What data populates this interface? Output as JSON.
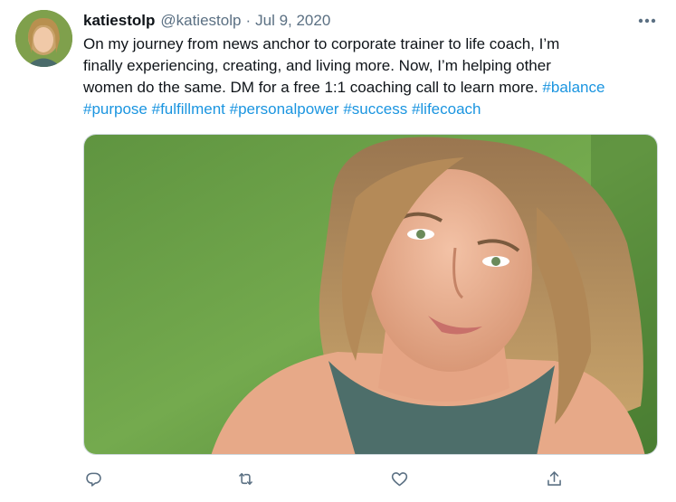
{
  "tweet": {
    "display_name": "katiestolp",
    "handle": "@katiestolp",
    "separator": "·",
    "date": "Jul 9, 2020",
    "text_lines": [
      "On my journey from news anchor to corporate trainer to life coach, I’m",
      "finally experiencing, creating, and living more. Now, I’m helping other",
      "women do the same. DM for a free 1:1 coaching call to learn more. "
    ],
    "hashtags_line3": [
      "#balance"
    ],
    "hashtags_line4": [
      "#purpose",
      "#fulfillment",
      "#personalpower",
      "#success",
      "#lifecoach"
    ]
  },
  "icons": {
    "more": "more-horizontal-icon",
    "reply": "reply-icon",
    "retweet": "retweet-icon",
    "like": "heart-icon",
    "share": "share-icon"
  },
  "colors": {
    "hashtag": "#1b95e0",
    "secondary_text": "#5b7083",
    "primary_text": "#0f1419"
  }
}
